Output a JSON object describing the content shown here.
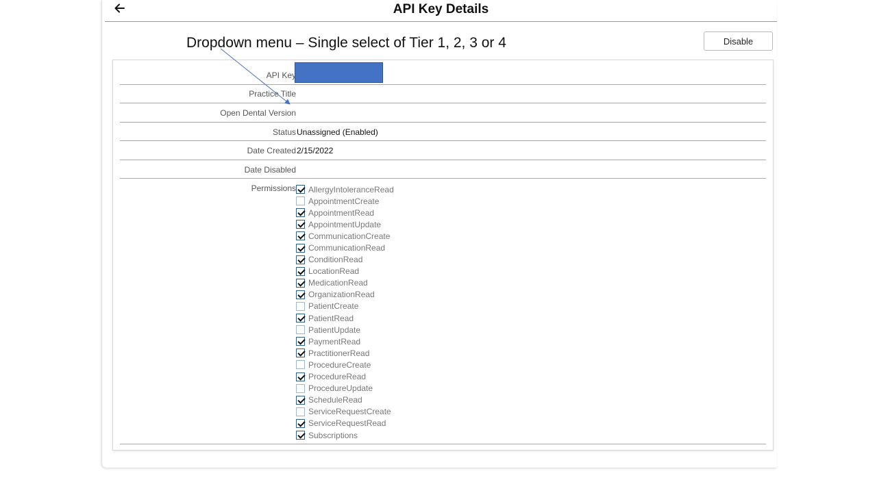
{
  "header": {
    "title": "API Key Details",
    "back_icon": "arrow-left-icon"
  },
  "toolbar": {
    "disable_label": "Disable"
  },
  "annotation": {
    "text": "Dropdown menu – Single select of Tier 1, 2, 3 or 4"
  },
  "details": {
    "api_key_label": "API Key",
    "api_key_value": "",
    "practice_title_label": "Practice Title",
    "practice_title_value": "",
    "open_dental_version_label": "Open Dental Version",
    "open_dental_version_value": "",
    "status_label": "Status",
    "status_value": "Unassigned (Enabled)",
    "date_created_label": "Date Created",
    "date_created_value": "2/15/2022",
    "date_disabled_label": "Date Disabled",
    "date_disabled_value": "",
    "permissions_label": "Permissions"
  },
  "permissions": [
    {
      "label": "AllergyIntoleranceRead",
      "checked": true
    },
    {
      "label": "AppointmentCreate",
      "checked": false
    },
    {
      "label": "AppointmentRead",
      "checked": true
    },
    {
      "label": "AppointmentUpdate",
      "checked": true
    },
    {
      "label": "CommunicationCreate",
      "checked": true
    },
    {
      "label": "CommunicationRead",
      "checked": true
    },
    {
      "label": "ConditionRead",
      "checked": true
    },
    {
      "label": "LocationRead",
      "checked": true
    },
    {
      "label": "MedicationRead",
      "checked": true
    },
    {
      "label": "OrganizationRead",
      "checked": true
    },
    {
      "label": "PatientCreate",
      "checked": false
    },
    {
      "label": "PatientRead",
      "checked": true
    },
    {
      "label": "PatientUpdate",
      "checked": false
    },
    {
      "label": "PaymentRead",
      "checked": true
    },
    {
      "label": "PractitionerRead",
      "checked": true
    },
    {
      "label": "ProcedureCreate",
      "checked": false
    },
    {
      "label": "ProcedureRead",
      "checked": true
    },
    {
      "label": "ProcedureUpdate",
      "checked": false
    },
    {
      "label": "ScheduleRead",
      "checked": true
    },
    {
      "label": "ServiceRequestCreate",
      "checked": false
    },
    {
      "label": "ServiceRequestRead",
      "checked": true
    },
    {
      "label": "Subscriptions",
      "checked": true
    }
  ],
  "colors": {
    "header_rule": "#5aa8d8",
    "api_key_fill": "#4472c4",
    "annotation_arrow": "#4472c4"
  }
}
